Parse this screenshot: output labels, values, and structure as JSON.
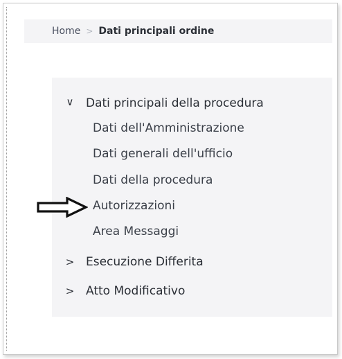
{
  "breadcrumb": {
    "home": "Home",
    "separator": ">",
    "current": "Dati principali ordine"
  },
  "menu": {
    "sections": [
      {
        "label": "Dati principali della procedura",
        "chevron": "∨",
        "expanded": true,
        "items": [
          {
            "label": "Dati dell'Amministrazione"
          },
          {
            "label": "Dati generali dell'ufficio"
          },
          {
            "label": "Dati della procedura"
          },
          {
            "label": "Autorizzazioni"
          },
          {
            "label": "Area Messaggi"
          }
        ]
      },
      {
        "label": "Esecuzione Differita",
        "chevron": ">",
        "expanded": false
      },
      {
        "label": "Atto Modificativo",
        "chevron": ">",
        "expanded": false
      }
    ]
  },
  "annotation": {
    "icon": "right-arrow-icon"
  }
}
